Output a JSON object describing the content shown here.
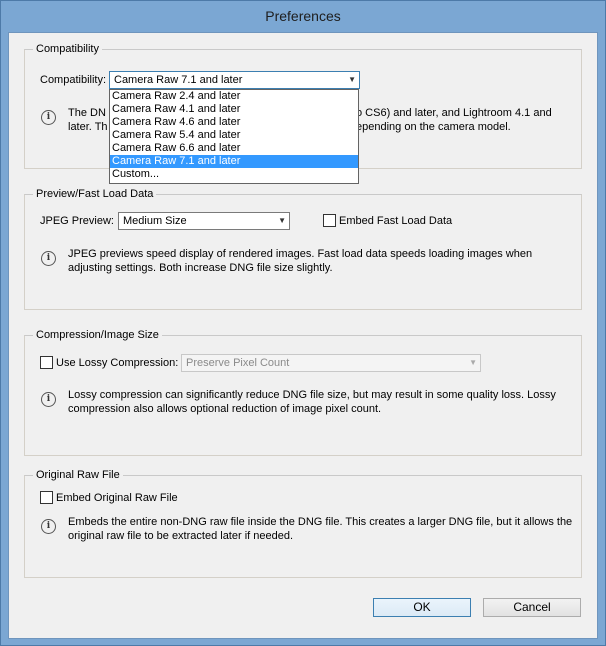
{
  "window": {
    "title": "Preferences"
  },
  "compatibility": {
    "group_title": "Compatibility",
    "label": "Compatibility:",
    "selected": "Camera Raw 7.1 and later",
    "options": [
      "Camera Raw 2.4 and later",
      "Camera Raw 4.1 and later",
      "Camera Raw 4.6 and later",
      "Camera Raw 5.4 and later",
      "Camera Raw 6.6 and later",
      "Camera Raw 7.1 and later",
      "Custom..."
    ],
    "selected_index": 5,
    "desc_line1_left": "The DN",
    "desc_line1_right": "o CS6) and later, and Lightroom 4.1 and",
    "desc_line2_left": "later. Th",
    "desc_line2_right": "epending on the camera model."
  },
  "preview": {
    "group_title": "Preview/Fast Load Data",
    "jpeg_label": "JPEG Preview:",
    "jpeg_value": "Medium Size",
    "embed_label": "Embed Fast Load Data",
    "embed_checked": false,
    "desc": "JPEG previews speed display of rendered images.  Fast load data speeds loading images when adjusting settings.  Both increase DNG file size slightly."
  },
  "compression": {
    "group_title": "Compression/Image Size",
    "lossy_label": "Use Lossy Compression:",
    "lossy_checked": false,
    "lossy_value": "Preserve Pixel Count",
    "desc": "Lossy compression can significantly reduce DNG file size, but may result in some quality loss.  Lossy compression also allows optional reduction of image pixel count."
  },
  "original": {
    "group_title": "Original Raw File",
    "embed_label": "Embed Original Raw File",
    "embed_checked": false,
    "desc": "Embeds the entire non-DNG raw file inside the DNG file.  This creates a larger DNG file, but it allows the original raw file to be extracted later if needed."
  },
  "buttons": {
    "ok": "OK",
    "cancel": "Cancel"
  },
  "icons": {
    "info": "info-icon",
    "dropdown": "chevron-down-icon"
  }
}
